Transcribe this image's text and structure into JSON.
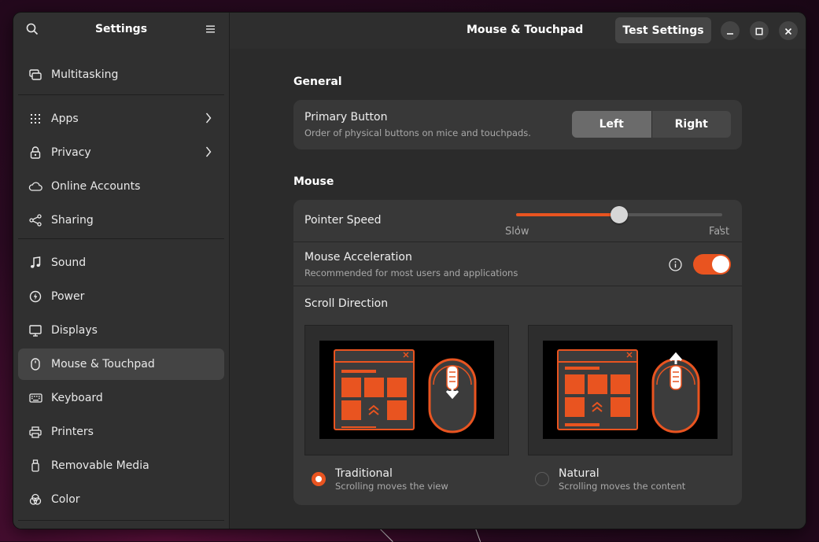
{
  "sidebar": {
    "title": "Settings",
    "items": [
      {
        "label": "Multitasking",
        "icon": "multitasking-icon"
      },
      {
        "label": "Apps",
        "icon": "apps-grid-icon",
        "chevron": true
      },
      {
        "label": "Privacy",
        "icon": "lock-icon",
        "chevron": true
      },
      {
        "label": "Online Accounts",
        "icon": "cloud-icon"
      },
      {
        "label": "Sharing",
        "icon": "share-icon"
      },
      {
        "label": "Sound",
        "icon": "music-note-icon"
      },
      {
        "label": "Power",
        "icon": "power-icon"
      },
      {
        "label": "Displays",
        "icon": "monitor-icon"
      },
      {
        "label": "Mouse & Touchpad",
        "icon": "mouse-icon",
        "active": true
      },
      {
        "label": "Keyboard",
        "icon": "keyboard-icon"
      },
      {
        "label": "Printers",
        "icon": "printer-icon"
      },
      {
        "label": "Removable Media",
        "icon": "usb-drive-icon"
      },
      {
        "label": "Color",
        "icon": "color-icon"
      }
    ]
  },
  "header": {
    "title": "Mouse & Touchpad",
    "test_button": "Test Settings"
  },
  "general": {
    "section_title": "General",
    "primary_button": {
      "title": "Primary Button",
      "subtitle": "Order of physical buttons on mice and touchpads.",
      "options": [
        "Left",
        "Right"
      ],
      "selected": "Left"
    }
  },
  "mouse": {
    "section_title": "Mouse",
    "pointer_speed": {
      "title": "Pointer Speed",
      "min_label": "Slow",
      "max_label": "Fast",
      "value": 0.5
    },
    "acceleration": {
      "title": "Mouse Acceleration",
      "subtitle": "Recommended for most users and applications",
      "enabled": true
    },
    "scroll_direction": {
      "title": "Scroll Direction",
      "options": [
        {
          "label": "Traditional",
          "subtitle": "Scrolling moves the view",
          "selected": true
        },
        {
          "label": "Natural",
          "subtitle": "Scrolling moves the content",
          "selected": false
        }
      ]
    }
  },
  "colors": {
    "accent": "#e95420",
    "window_bg": "#2b2b2b",
    "card_bg": "#383838"
  }
}
